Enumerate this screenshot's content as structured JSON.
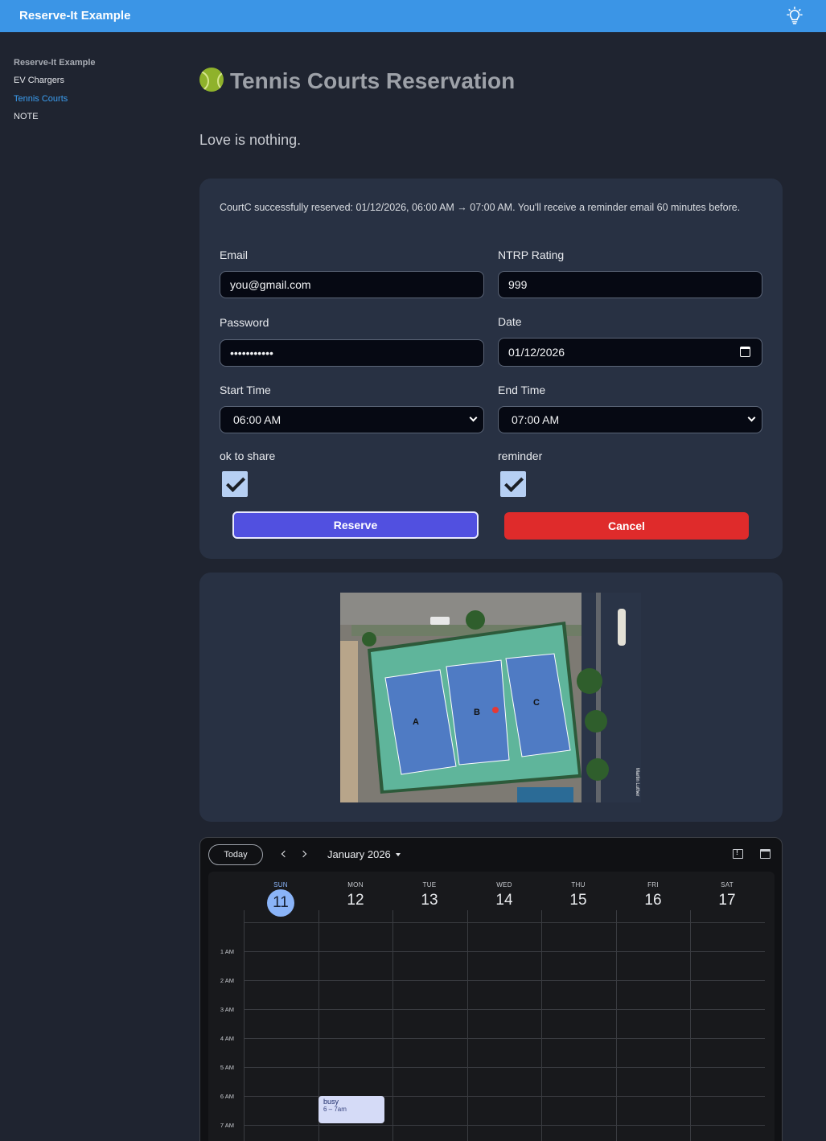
{
  "app": {
    "title": "Reserve-It Example",
    "theme_icon": "lightbulb-icon"
  },
  "sidebar": {
    "items": [
      {
        "label": "Reserve-It Example"
      },
      {
        "label": "EV Chargers"
      },
      {
        "label": "Tennis Courts"
      },
      {
        "label": "NOTE"
      }
    ],
    "active": "Tennis Courts"
  },
  "page": {
    "title": "Tennis Courts Reservation",
    "title_icon": "tennis-ball-icon",
    "subtitle": "Love is nothing."
  },
  "form": {
    "status_message": "CourtC successfully reserved: 01/12/2026, 06:00 AM → 07:00 AM. You'll receive a reminder email 60 minutes before.",
    "email": {
      "label": "Email",
      "value": "you@gmail.com"
    },
    "ntrp": {
      "label": "NTRP Rating",
      "value": "999"
    },
    "password": {
      "label": "Password",
      "value": "•••••••••••"
    },
    "date": {
      "label": "Date",
      "value": "01/12/2026"
    },
    "start_time": {
      "label": "Start Time",
      "value": "06:00 AM"
    },
    "end_time": {
      "label": "End Time",
      "value": "07:00 AM"
    },
    "ok_to_share": {
      "label": "ok to share",
      "checked": true
    },
    "reminder": {
      "label": "reminder",
      "checked": true
    },
    "reserve_label": "Reserve",
    "cancel_label": "Cancel"
  },
  "map": {
    "court_labels": [
      "A",
      "B",
      "C"
    ],
    "street_label": "Martin Luther"
  },
  "calendar": {
    "today_label": "Today",
    "month_label": "January 2026",
    "days": [
      {
        "name": "SUN",
        "date": "11",
        "today": true
      },
      {
        "name": "MON",
        "date": "12"
      },
      {
        "name": "TUE",
        "date": "13"
      },
      {
        "name": "WED",
        "date": "14"
      },
      {
        "name": "THU",
        "date": "15"
      },
      {
        "name": "FRI",
        "date": "16"
      },
      {
        "name": "SAT",
        "date": "17"
      }
    ],
    "hours": [
      "1 AM",
      "2 AM",
      "3 AM",
      "4 AM",
      "5 AM",
      "6 AM",
      "7 AM"
    ],
    "event": {
      "title": "busy",
      "time": "6 – 7am"
    }
  }
}
